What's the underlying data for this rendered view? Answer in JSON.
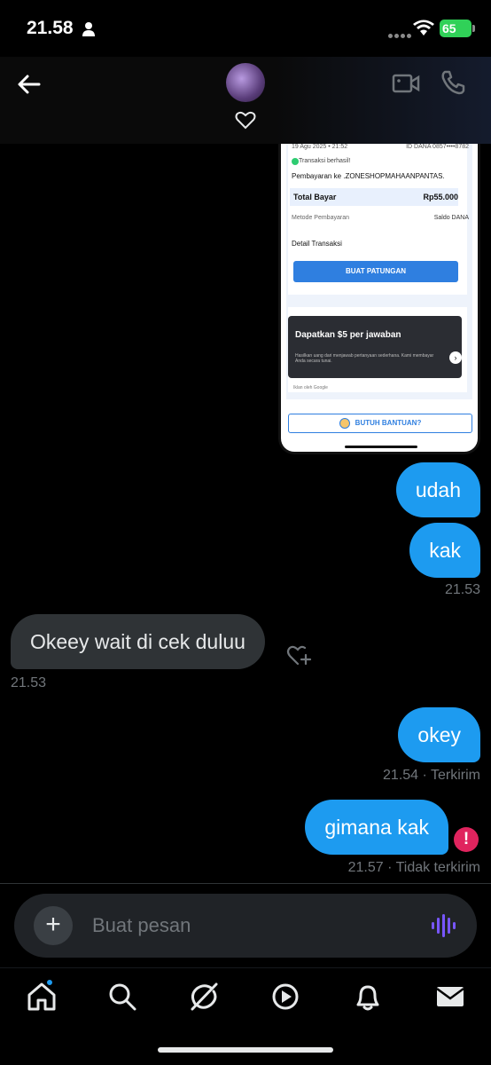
{
  "status_bar": {
    "time": "21.58",
    "battery": "65"
  },
  "shared_image": {
    "date": "19 Agu 2025 • 21:52",
    "id": "ID DANA 0857••••8782",
    "status": "Transaksi berhasil!",
    "payee": "Pembayaran ke .ZONESHOPMAHAANPANTAS.",
    "total_label": "Total Bayar",
    "total_value": "Rp55.000",
    "method_label": "Metode Pembayaran",
    "method_value": "Saldo DANA",
    "detail_label": "Detail Transaksi",
    "split_button": "BUAT PATUNGAN",
    "ad_title": "Dapatkan $5 per jawaban",
    "ad_sub": "Hasilkan uang dari menjawab pertanyaan sederhana. Kami membayar Anda secara tunai.",
    "ad_by": "Iklan oleh Google",
    "help_button": "BUTUH BANTUAN?"
  },
  "messages": [
    {
      "text": "udah",
      "direction": "out"
    },
    {
      "text": "kak",
      "direction": "out",
      "meta": "21.53"
    },
    {
      "text": "Okeey wait di cek duluu",
      "direction": "in",
      "meta": "21.53"
    },
    {
      "text": "okey",
      "direction": "out",
      "meta": "21.54 · Terkirim"
    },
    {
      "text": "gimana kak",
      "direction": "out",
      "meta": "21.57 · Tidak terkirim"
    }
  ],
  "composer": {
    "placeholder": "Buat pesan"
  },
  "colors": {
    "accent": "#1d9bf0",
    "error": "#e0245e",
    "incoming": "#2f3336"
  },
  "nav": {
    "icons": [
      "home-icon",
      "search-icon",
      "grok-icon",
      "video-icon",
      "notifications-icon",
      "messages-icon"
    ]
  }
}
